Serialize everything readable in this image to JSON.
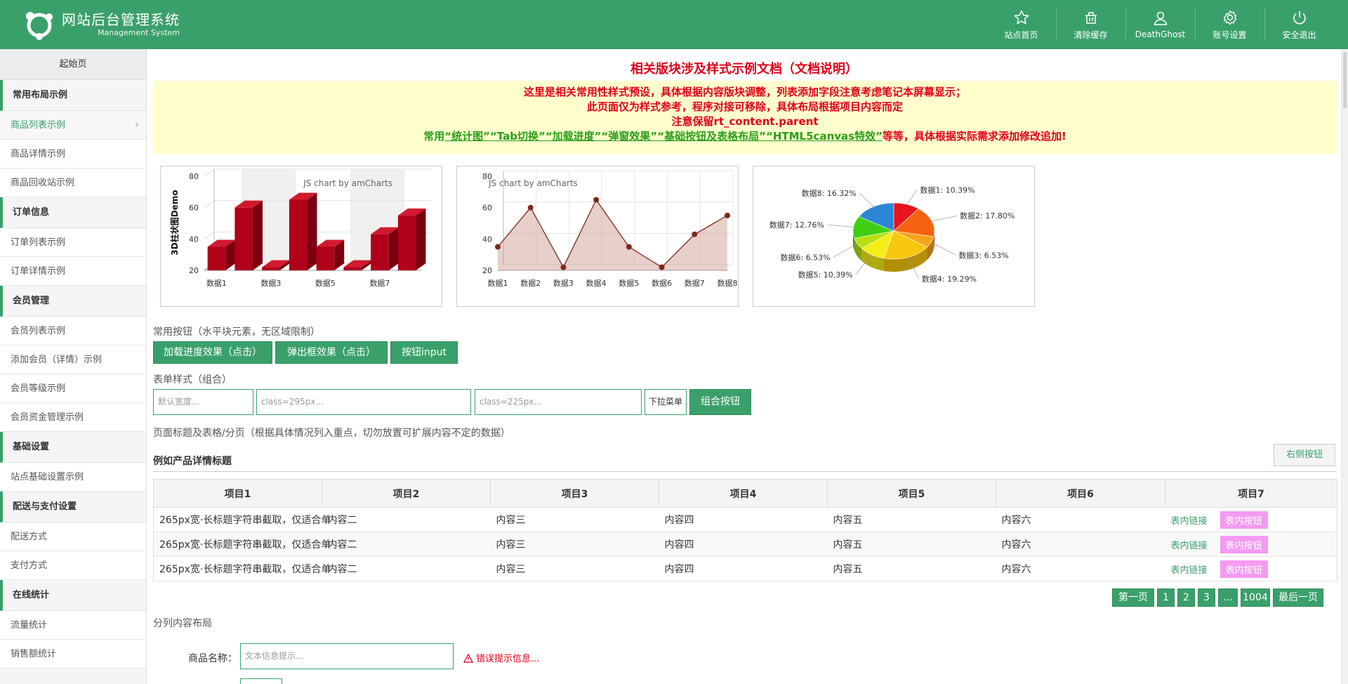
{
  "header": {
    "title": "网站后台管理系统",
    "subtitle": "Management System",
    "nav": [
      {
        "label": "站点首页",
        "icon": "star-icon"
      },
      {
        "label": "清除缓存",
        "icon": "trash-icon"
      },
      {
        "label": "DeathGhost",
        "icon": "user-icon"
      },
      {
        "label": "账号设置",
        "icon": "gear-icon"
      },
      {
        "label": "安全退出",
        "icon": "power-icon"
      }
    ]
  },
  "sidebar": {
    "home": "起始页",
    "groups": [
      {
        "title": "常用布局示例",
        "items": [
          "商品列表示例",
          "商品详情示例",
          "商品回收站示例"
        ]
      },
      {
        "title": "订单信息",
        "items": [
          "订单列表示例",
          "订单详情示例"
        ]
      },
      {
        "title": "会员管理",
        "items": [
          "会员列表示例",
          "添加会员（详情）示例",
          "会员等级示例",
          "会员资金管理示例"
        ]
      },
      {
        "title": "基础设置",
        "items": [
          "站点基础设置示例"
        ]
      },
      {
        "title": "配送与支付设置",
        "items": [
          "配送方式",
          "支付方式"
        ]
      },
      {
        "title": "在线统计",
        "items": [
          "流量统计",
          "销售额统计"
        ]
      }
    ],
    "active_item": "商品列表示例",
    "chevron": "›"
  },
  "main": {
    "doc_title": "相关版块涉及样式示例文档（文档说明）",
    "notice": {
      "line1": "这里是相关常用性样式预设，具体根据内容版块调整，列表添加字段注意考虑笔记本屏幕显示；",
      "line2": "此页面仅为样式参考，程序对接可移除，具体布局根据项目内容而定",
      "line3": "注意保留rt_content.parent",
      "line4_prefix": "常用",
      "line4_links": [
        "“统计图”",
        "“Tab切换”",
        "“加载进度”",
        "“弹窗效果”",
        "“基础按钮及表格布局”",
        "“HTML5canvas特效”"
      ],
      "line4_suffix": "等等，具体根据实际需求添加修改追加!"
    },
    "buttons_section": {
      "label": "常用按钮（水平块元素，无区域限制）",
      "buttons": [
        "加载进度效果（点击）",
        "弹出框效果（点击）",
        "按钮input"
      ]
    },
    "form_section": {
      "label": "表单样式（组合）",
      "placeholders": [
        "默认宽度...",
        "class=295px...",
        "class=225px..."
      ],
      "select_label": "下拉菜单",
      "group_button": "组合按钮"
    },
    "table_section": {
      "label": "页面标题及表格/分页（根据具体情况列入重点，切勿放置可扩展内容不定的数据）",
      "title": "例如产品详情标题",
      "right_button": "右侧按钮",
      "headers": [
        "项目1",
        "项目2",
        "项目3",
        "项目4",
        "项目5",
        "项目6",
        "项目7"
      ],
      "rows": [
        {
          "c1": "265px宽·长标题字符串截取，仅适合单",
          "c2": "内容二",
          "c3": "内容三",
          "c4": "内容四",
          "c5": "内容五",
          "c6": "内容六",
          "link": "表内链接",
          "btn": "表内按钮"
        },
        {
          "c1": "265px宽·长标题字符串截取，仅适合单",
          "c2": "内容二",
          "c3": "内容三",
          "c4": "内容四",
          "c5": "内容五",
          "c6": "内容六",
          "link": "表内链接",
          "btn": "表内按钮"
        },
        {
          "c1": "265px宽·长标题字符串截取，仅适合单",
          "c2": "内容二",
          "c3": "内容三",
          "c4": "内容四",
          "c5": "内容五",
          "c6": "内容六",
          "link": "表内链接",
          "btn": "表内按钮"
        }
      ],
      "pagination": [
        "第一页",
        "1",
        "2",
        "3",
        "...",
        "1004",
        "最后一页"
      ]
    },
    "split_section": {
      "label": "分列内容布局",
      "field_label": "商品名称：",
      "field_placeholder": "文本信息提示...",
      "error": "错误提示信息..."
    }
  },
  "chart_data": [
    {
      "type": "bar",
      "title": "3D柱状图Demo",
      "watermark": "JS chart by amCharts",
      "categories": [
        "数据1",
        "数据2",
        "数据3",
        "数据4",
        "数据5",
        "数据6",
        "数据7",
        "数据8"
      ],
      "tick_labels": [
        "数据1",
        "数据3",
        "数据5",
        "数据7"
      ],
      "values": [
        35,
        60,
        22,
        65,
        35,
        22,
        43,
        55
      ],
      "ylim": [
        20,
        80
      ],
      "yticks": [
        20,
        40,
        60,
        80
      ],
      "color": "#b0001a"
    },
    {
      "type": "area",
      "watermark": "JS chart by amCharts",
      "categories": [
        "数据1",
        "数据2",
        "数据3",
        "数据4",
        "数据5",
        "数据6",
        "数据7",
        "数据8"
      ],
      "values": [
        35,
        60,
        22,
        65,
        35,
        22,
        43,
        55
      ],
      "ylim": [
        20,
        80
      ],
      "yticks": [
        20,
        40,
        60,
        80
      ],
      "color": "#7a2a1a"
    },
    {
      "type": "pie",
      "slices": [
        {
          "label": "数据1: 10.39%",
          "value": 10.39,
          "color": "#e8141b"
        },
        {
          "label": "数据2: 17.80%",
          "value": 17.8,
          "color": "#f6620f"
        },
        {
          "label": "数据3: 6.53%",
          "value": 6.53,
          "color": "#f7a31a"
        },
        {
          "label": "数据4: 19.29%",
          "value": 19.29,
          "color": "#f9c70d"
        },
        {
          "label": "数据5: 10.39%",
          "value": 10.39,
          "color": "#f3ee15"
        },
        {
          "label": "数据6: 6.53%",
          "value": 6.53,
          "color": "#b8df12"
        },
        {
          "label": "数据7: 12.76%",
          "value": 12.76,
          "color": "#3fcf14"
        },
        {
          "label": "数据8: 16.32%",
          "value": 16.32,
          "color": "#2e86d6"
        }
      ]
    }
  ],
  "colors": {
    "primary": "#3aa06a",
    "alert": "#e0001a",
    "notice_bg": "#ffffcc",
    "table_button": "#f49af2"
  }
}
